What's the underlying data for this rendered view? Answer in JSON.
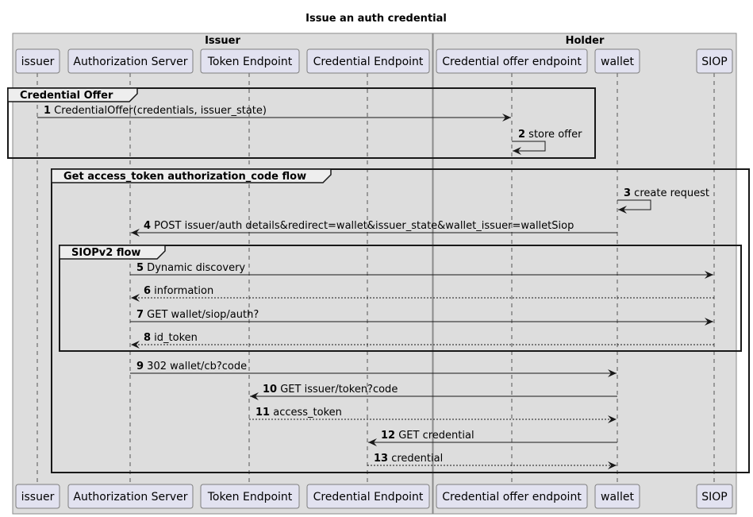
{
  "title": "Issue an auth credential",
  "colors": {
    "box_fill": "#dddddd",
    "box_stroke": "#8a8a8a",
    "participant_fill": "#e2e2f0",
    "participant_stroke": "#7f7f7f",
    "line": "#181818",
    "lifeline": "#555555",
    "group_tab_fill": "#eeeeee"
  },
  "boxes": [
    {
      "id": "issuer-box",
      "label": "Issuer",
      "participants": [
        "issuer",
        "auth",
        "token",
        "credep"
      ]
    },
    {
      "id": "holder-box",
      "label": "Holder",
      "participants": [
        "offerep",
        "wallet",
        "siop"
      ]
    }
  ],
  "participants": [
    {
      "id": "issuer",
      "label": "issuer"
    },
    {
      "id": "auth",
      "label": "Authorization Server"
    },
    {
      "id": "token",
      "label": "Token Endpoint"
    },
    {
      "id": "credep",
      "label": "Credential Endpoint"
    },
    {
      "id": "offerep",
      "label": "Credential offer endpoint"
    },
    {
      "id": "wallet",
      "label": "wallet"
    },
    {
      "id": "siop",
      "label": "SIOP"
    }
  ],
  "groups": [
    {
      "id": "credential-offer",
      "label": "Credential Offer",
      "from_msg": 1,
      "to_msg": 2
    },
    {
      "id": "get-access-token",
      "label": "Get access_token authorization_code flow",
      "from_msg": 3,
      "to_msg": 13
    },
    {
      "id": "siopv2",
      "label": "SIOPv2 flow",
      "from_msg": 5,
      "to_msg": 8
    }
  ],
  "messages": [
    {
      "num": "1",
      "from": "issuer",
      "to": "offerep",
      "text": "CredentialOffer(credentials, issuer_state)",
      "style": "solid"
    },
    {
      "num": "2",
      "from": "offerep",
      "to": "offerep",
      "text": "store offer",
      "style": "solid"
    },
    {
      "num": "3",
      "from": "wallet",
      "to": "wallet",
      "text": "create request",
      "style": "solid"
    },
    {
      "num": "4",
      "from": "wallet",
      "to": "auth",
      "text": "POST issuer/auth details&redirect=wallet&issuer_state&wallet_issuer=walletSiop",
      "style": "solid"
    },
    {
      "num": "5",
      "from": "auth",
      "to": "siop",
      "text": "Dynamic discovery",
      "style": "solid"
    },
    {
      "num": "6",
      "from": "siop",
      "to": "auth",
      "text": "information",
      "style": "dashed"
    },
    {
      "num": "7",
      "from": "auth",
      "to": "siop",
      "text": "GET wallet/siop/auth?",
      "style": "solid"
    },
    {
      "num": "8",
      "from": "siop",
      "to": "auth",
      "text": "id_token",
      "style": "dashed"
    },
    {
      "num": "9",
      "from": "auth",
      "to": "wallet",
      "text": "302 wallet/cb?code",
      "style": "solid"
    },
    {
      "num": "10",
      "from": "wallet",
      "to": "token",
      "text": "GET issuer/token?code",
      "style": "solid"
    },
    {
      "num": "11",
      "from": "token",
      "to": "wallet",
      "text": "access_token",
      "style": "dashed"
    },
    {
      "num": "12",
      "from": "wallet",
      "to": "credep",
      "text": "GET credential",
      "style": "solid"
    },
    {
      "num": "13",
      "from": "credep",
      "to": "wallet",
      "text": "credential",
      "style": "dashed"
    }
  ]
}
